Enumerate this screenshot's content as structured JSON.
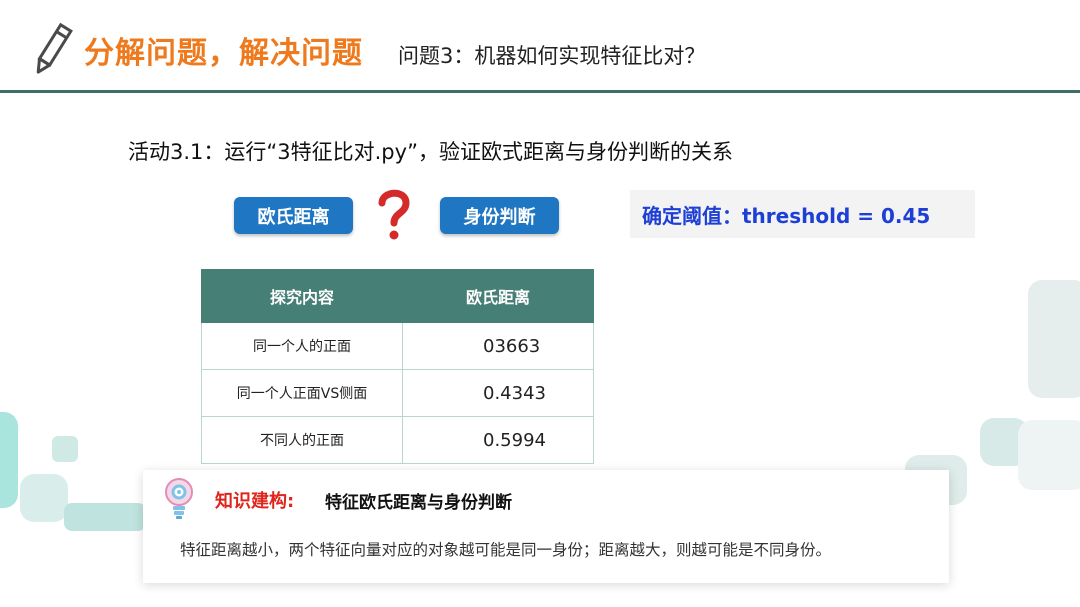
{
  "header": {
    "title": "分解问题，解决问题",
    "question": "问题3：机器如何实现特征比对？"
  },
  "activity": "活动3.1：运行“3特征比对.py”，验证欧式距离与身份判断的关系",
  "tags": {
    "left": "欧氏距离",
    "right": "身份判断"
  },
  "threshold": "确定阈值：threshold = 0.45",
  "table": {
    "headers": [
      "探究内容",
      "欧氏距离"
    ],
    "rows": [
      [
        "同一个人的正面",
        "03663"
      ],
      [
        "同一个人正面VS侧面",
        "0.4343"
      ],
      [
        "不同人的正面",
        "0.5994"
      ]
    ]
  },
  "knowledge": {
    "label": "知识建构:",
    "title": "特征欧氏距离与身份判断",
    "text": "特征距离越小，两个特征向量对应的对象越可能是同一身份；距离越大，则越可能是不同身份。"
  },
  "colors": {
    "title_orange": "#ef7a1e",
    "header_rule": "#3f6d67",
    "tag_blue": "#1f76c2",
    "threshold_blue": "#1d3fd6",
    "table_header": "#457f75",
    "label_red": "#e0251b"
  },
  "icons": {
    "header": "pencil-icon",
    "between_tags": "question-mark-icon",
    "knowledge": "lightbulb-gear-icon"
  }
}
